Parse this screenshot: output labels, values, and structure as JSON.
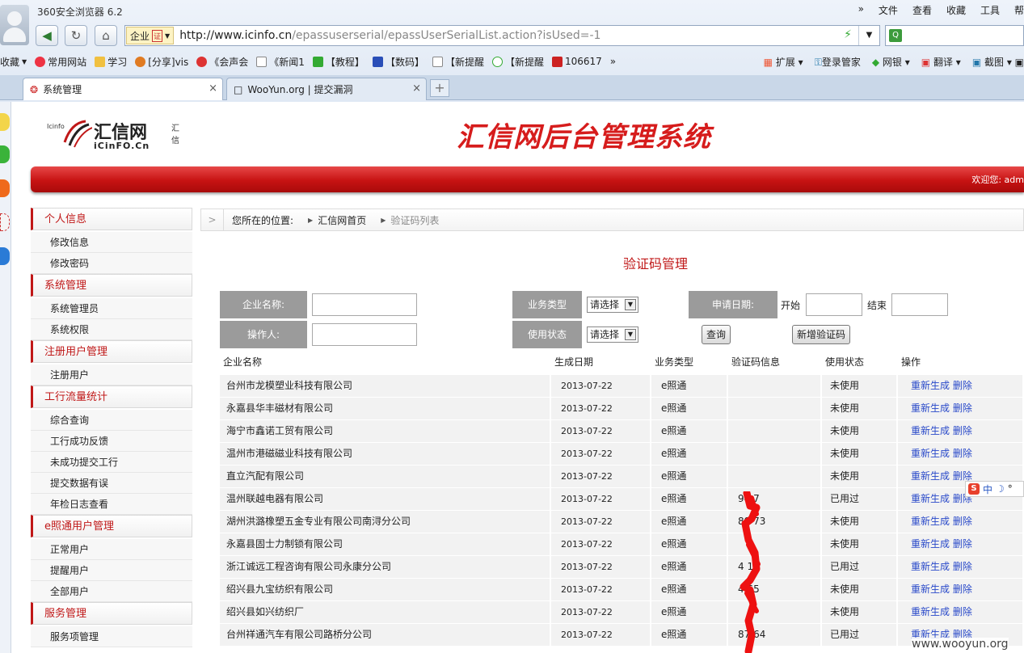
{
  "browser": {
    "title": "360安全浏览器 6.2",
    "menu": [
      "文件",
      "查看",
      "收藏",
      "工具",
      "帮"
    ],
    "menu_more": "»",
    "enterprise_label": "企业",
    "enterprise_badge": "证",
    "url_domain": "http://www.icinfo.cn",
    "url_path": "/epassuserserial/epassUserSerialList.action?isUsed=-1",
    "bookmarks": [
      "收藏",
      "常用网站",
      "学习",
      "[分享]vis",
      "《会声会",
      "《新闻1",
      "【教程】",
      "【数码】",
      "【新提醒",
      "【新提醒",
      "106617"
    ],
    "bookmarks_more": "»",
    "tools": [
      "扩展",
      "登录管家",
      "网银",
      "翻译",
      "截图"
    ],
    "tabs": [
      {
        "label": "系统管理",
        "close": "×"
      },
      {
        "label": "WooYun.org | 提交漏洞",
        "close": "×"
      }
    ],
    "new_tab": "+"
  },
  "header": {
    "logo_brand": "汇信网",
    "logo_brand_sub": "汇信",
    "logo_en": "iCinFO.Cn",
    "logo_tiny": "Icinfo",
    "system_title": "汇信网后台管理系统",
    "welcome": "欢迎您: adm"
  },
  "sidebar": [
    {
      "title": "个人信息",
      "items": [
        "修改信息",
        "修改密码"
      ]
    },
    {
      "title": "系统管理",
      "items": [
        "系统管理员",
        "系统权限"
      ]
    },
    {
      "title": "注册用户管理",
      "items": [
        "注册用户"
      ]
    },
    {
      "title": "工行流量统计",
      "items": [
        "综合查询",
        "工行成功反馈",
        "未成功提交工行",
        "提交数据有误",
        "年检日志查看"
      ]
    },
    {
      "title": "e照通用户管理",
      "items": [
        "正常用户",
        "提醒用户",
        "全部用户"
      ]
    },
    {
      "title": "服务管理",
      "items": [
        "服务项管理"
      ]
    }
  ],
  "breadcrumb": {
    "arrow": ">",
    "label": "您所在的位置:",
    "home": "汇信网首页",
    "current": "验证码列表"
  },
  "page_title": "验证码管理",
  "filters": {
    "company_label": "企业名称:",
    "company_value": "",
    "biz_type_label": "业务类型",
    "biz_type_value": "请选择",
    "apply_date_label": "申请日期:",
    "start_label": "开始",
    "end_label": "结束",
    "operator_label": "操作人:",
    "operator_value": "",
    "status_label": "使用状态",
    "status_value": "请选择",
    "query_button": "查询",
    "add_button": "新增验证码"
  },
  "table": {
    "columns": [
      "企业名称",
      "生成日期",
      "业务类型",
      "验证码信息",
      "使用状态",
      "操作"
    ],
    "actions": [
      "重新生成",
      "删除"
    ],
    "rows": [
      [
        "台州市龙模塑业科技有限公司",
        "2013-07-22",
        "e照通",
        "",
        "未使用"
      ],
      [
        "永嘉县华丰磁材有限公司",
        "2013-07-22",
        "e照通",
        "",
        "未使用"
      ],
      [
        "海宁市鑫诺工贸有限公司",
        "2013-07-22",
        "e照通",
        "",
        "未使用"
      ],
      [
        "温州市港磁磁业科技有限公司",
        "2013-07-22",
        "e照通",
        "",
        "未使用"
      ],
      [
        "直立汽配有限公司",
        "2013-07-22",
        "e照通",
        "",
        "未使用"
      ],
      [
        "温州联越电器有限公司",
        "2013-07-22",
        "e照通",
        "94 7",
        "已用过"
      ],
      [
        "湖州洪潞橡塑五金专业有限公司南浔分公司",
        "2013-07-22",
        "e照通",
        "89 73",
        "未使用"
      ],
      [
        "永嘉县固士力制锁有限公司",
        "2013-07-22",
        "e照通",
        "",
        "未使用"
      ],
      [
        "浙江诚远工程咨询有限公司永康分公司",
        "2013-07-22",
        "e照通",
        "4 16",
        "已用过"
      ],
      [
        "绍兴县九宝纺织有限公司",
        "2013-07-22",
        "e照通",
        "4 65",
        "未使用"
      ],
      [
        "绍兴县如兴纺织厂",
        "2013-07-22",
        "e照通",
        "",
        "未使用"
      ],
      [
        "台州祥通汽车有限公司路桥分公司",
        "2013-07-22",
        "e照通",
        "87 64",
        "已用过"
      ]
    ]
  },
  "ime": {
    "logo": "S",
    "lang": "中",
    "moon": "☽",
    "dot": "°"
  },
  "watermark": "www.wooyun.org"
}
